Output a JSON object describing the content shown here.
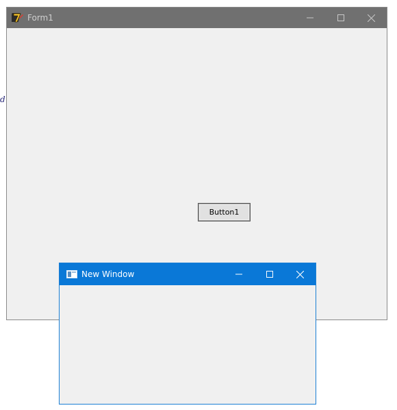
{
  "background_text": "d",
  "form1": {
    "title": "Form1",
    "icon": "delphi-app-icon",
    "caption": {
      "minimize": "minimize-icon",
      "maximize": "maximize-icon",
      "close": "close-icon"
    },
    "button1_label": "Button1",
    "colors": {
      "titlebar": "#707070",
      "client": "#f0f0f0"
    }
  },
  "new_window": {
    "title": "New Window",
    "icon": "window-app-icon",
    "caption": {
      "minimize": "minimize-icon",
      "maximize": "maximize-icon",
      "close": "close-icon"
    },
    "colors": {
      "titlebar": "#0a78d7",
      "client": "#f0f0f0"
    }
  }
}
